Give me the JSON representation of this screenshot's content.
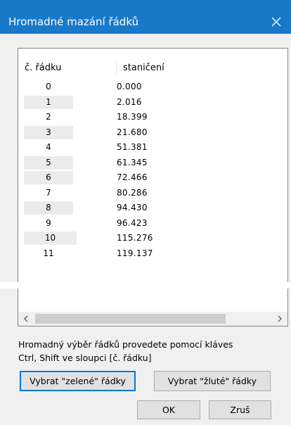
{
  "window": {
    "title": "Hromadné mazání řádků",
    "close_icon": "close-icon"
  },
  "table": {
    "headers": {
      "row_number": "č. řádku",
      "stationing": "staničení"
    },
    "rows": [
      {
        "num": "0",
        "station": "0.000",
        "shaded": false
      },
      {
        "num": "1",
        "station": "2.016",
        "shaded": true
      },
      {
        "num": "2",
        "station": "18.399",
        "shaded": false
      },
      {
        "num": "3",
        "station": "21.680",
        "shaded": true
      },
      {
        "num": "4",
        "station": "51.381",
        "shaded": false
      },
      {
        "num": "5",
        "station": "61.345",
        "shaded": true
      },
      {
        "num": "6",
        "station": "72.466",
        "shaded": true
      },
      {
        "num": "7",
        "station": "80.286",
        "shaded": false
      },
      {
        "num": "8",
        "station": "94.430",
        "shaded": true
      },
      {
        "num": "9",
        "station": "96.423",
        "shaded": false
      },
      {
        "num": "10",
        "station": "115.276",
        "shaded": true
      },
      {
        "num": "11",
        "station": "119.137",
        "shaded": false
      }
    ]
  },
  "scrollbar": {
    "left_icon": "scroll-left-arrow-icon",
    "right_icon": "scroll-right-arrow-icon"
  },
  "hint": {
    "line1": "Hromadný výběr řádků provedete pomocí kláves",
    "line2": "Ctrl, Shift ve sloupci [č. řádku]"
  },
  "buttons": {
    "select_green": "Vybrat \"zelené\" řádky",
    "select_yellow": "Vybrat \"žluté\" řádky",
    "ok": "OK",
    "cancel": "Zruš"
  },
  "colors": {
    "titlebar": "#1979c9",
    "shaded_cell": "#ebebeb",
    "focus_border": "#0078d7"
  }
}
